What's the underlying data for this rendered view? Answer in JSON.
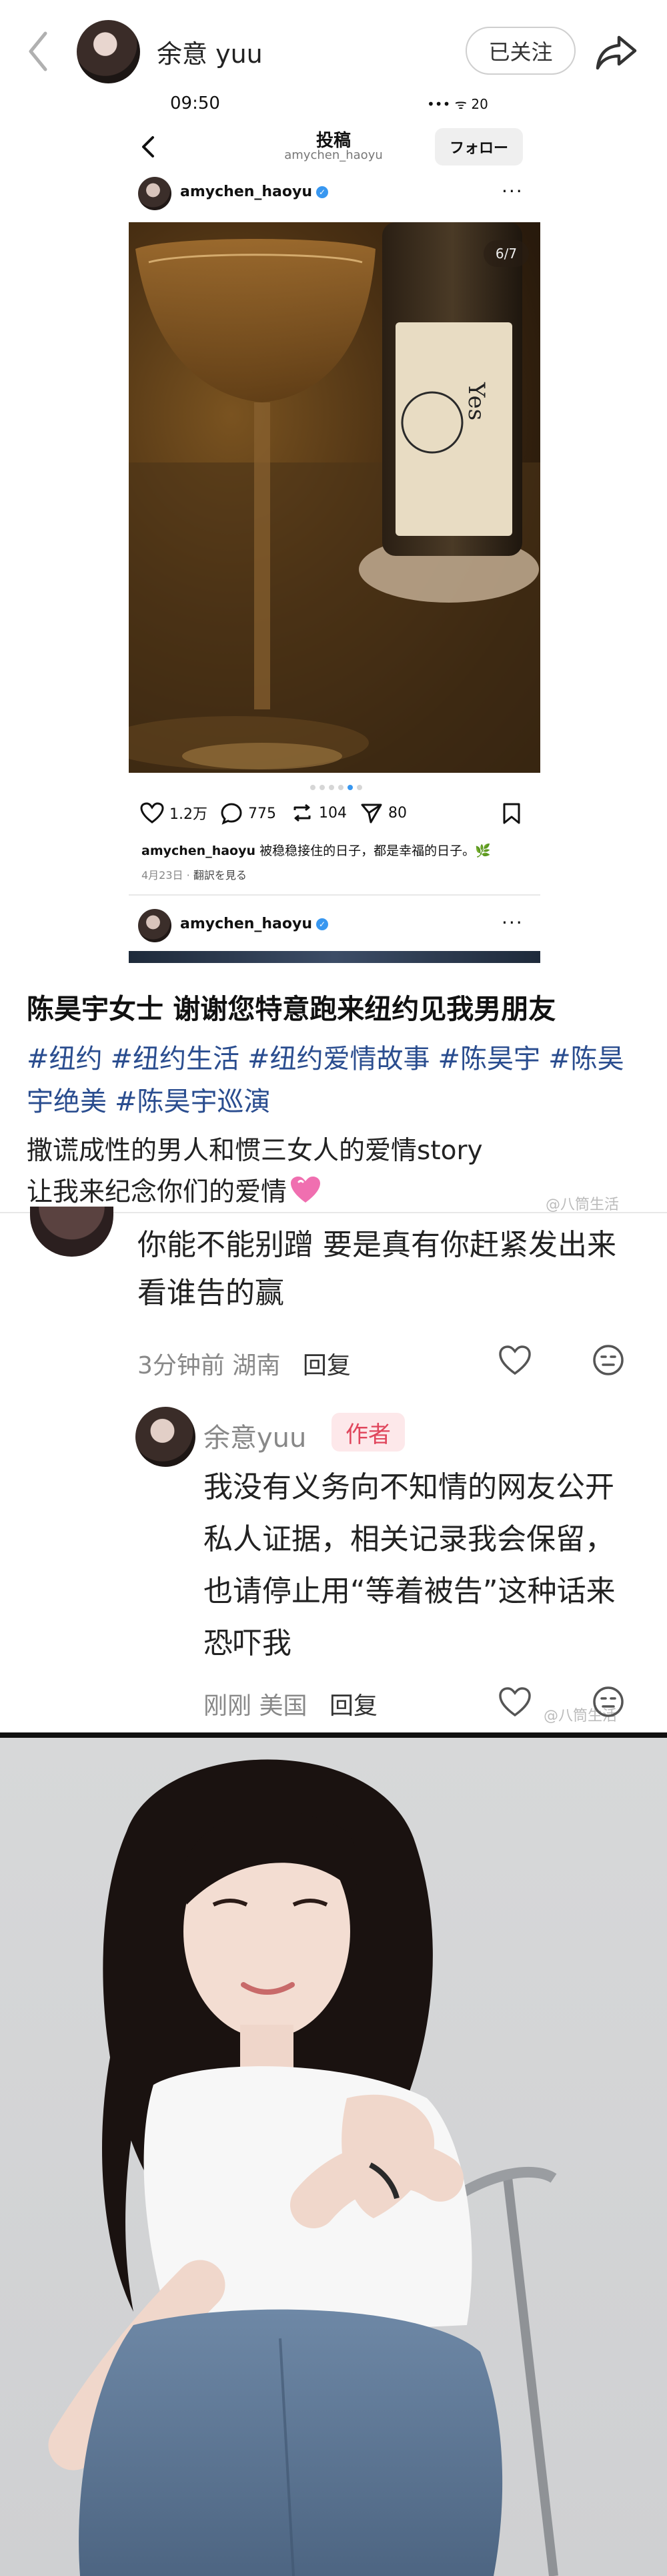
{
  "header": {
    "username": "余意 yuu",
    "follow_label": "已关注"
  },
  "embed": {
    "status_time": "09:50",
    "status_icons": "••• ᯤ 20",
    "title": "投稿",
    "subtitle": "amychen_haoyu",
    "follow_label": "フォロー",
    "post_user": "amychen_haoyu",
    "more": "···",
    "photo_counter": "6/7",
    "bottle_text": "Yes",
    "actions": {
      "likes": "1.2万",
      "comments": "775",
      "reposts": "104",
      "shares": "80"
    },
    "caption_user": "amychen_haoyu",
    "caption_text": "被稳稳接住的日子，都是幸福的日子。🌿",
    "date": "4月23日 · ",
    "translate": "翻訳を見る",
    "second_post_user": "amychen_haoyu",
    "second_more": "···"
  },
  "post": {
    "title": "陈昊宇女士 谢谢您特意跑来纽约见我男朋友",
    "tags": [
      "#纽约",
      "#纽约生活",
      "#纽约爱情故事",
      "#陈昊宇",
      "#陈昊宇绝美",
      "#陈昊宇巡演"
    ],
    "line1": "撒谎成性的男人和惯三女人的爱情story",
    "line2": "让我来纪念你们的爱情",
    "watermark": "@八筒生活"
  },
  "comments": [
    {
      "text": "你能不能别蹭 要是真有你赶紧发出来 看谁告的赢",
      "time": "3分钟前",
      "location": "湖南",
      "reply_label": "回复"
    },
    {
      "name": "余意yuu",
      "badge": "作者",
      "text": "我没有义务向不知情的网友公开私人证据，相关记录我会保留，也请停止用“等着被告”这种话来恐吓我",
      "time": "刚刚",
      "location": "美国",
      "reply_label": "回复",
      "watermark": "@八筒生活"
    }
  ],
  "colors": {
    "tag_blue": "#2a4d8f",
    "author_badge_bg": "#fde8ea",
    "author_badge_text": "#e0465c",
    "ig_verified": "#3897f0"
  }
}
